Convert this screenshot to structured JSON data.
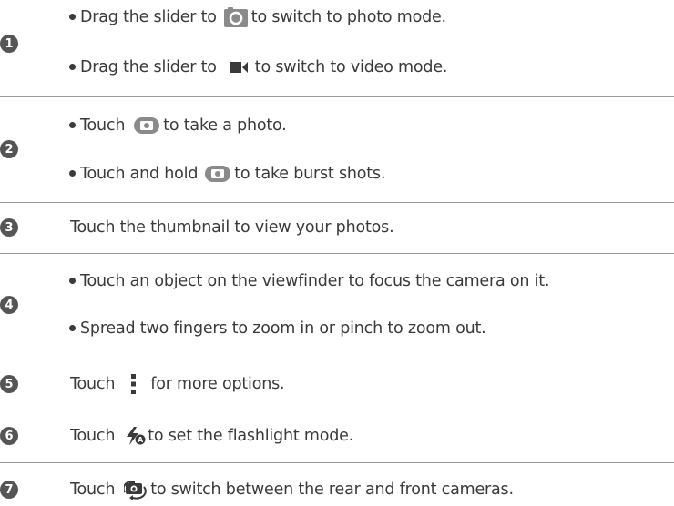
{
  "rows": [
    {
      "number": "1",
      "lines": [
        {
          "before": "Drag the slider to",
          "icon": "camera-box-icon",
          "after": "to switch to photo mode."
        },
        {
          "before": "Drag the slider to",
          "icon": "video-camera-icon",
          "after": "to switch to video mode."
        }
      ]
    },
    {
      "number": "2",
      "lines": [
        {
          "before": "Touch",
          "icon": "shutter-button-icon",
          "after": "to take a photo."
        },
        {
          "before": "Touch and hold",
          "icon": "shutter-button-icon",
          "after": "to take burst shots."
        }
      ]
    },
    {
      "number": "3",
      "lines": [
        {
          "text": "Touch the thumbnail to view your photos."
        }
      ]
    },
    {
      "number": "4",
      "lines": [
        {
          "text": "Touch an object on the viewfinder to focus the camera on it."
        },
        {
          "text": "Spread two fingers to zoom in or pinch to zoom out."
        }
      ]
    },
    {
      "number": "5",
      "lines": [
        {
          "before": "Touch",
          "icon": "more-options-icon",
          "after": "for more options."
        }
      ]
    },
    {
      "number": "6",
      "lines": [
        {
          "before": "Touch",
          "icon": "flash-auto-icon",
          "after": "to set the flashlight mode."
        }
      ]
    },
    {
      "number": "7",
      "lines": [
        {
          "before": "Touch",
          "icon": "switch-camera-icon",
          "after": "to switch between the rear and front cameras."
        }
      ]
    }
  ],
  "colors": {
    "text": "#3a3a3a",
    "badge": "#555555",
    "divider": "#9a9a9a",
    "icon_gray": "#8a8a8a"
  }
}
